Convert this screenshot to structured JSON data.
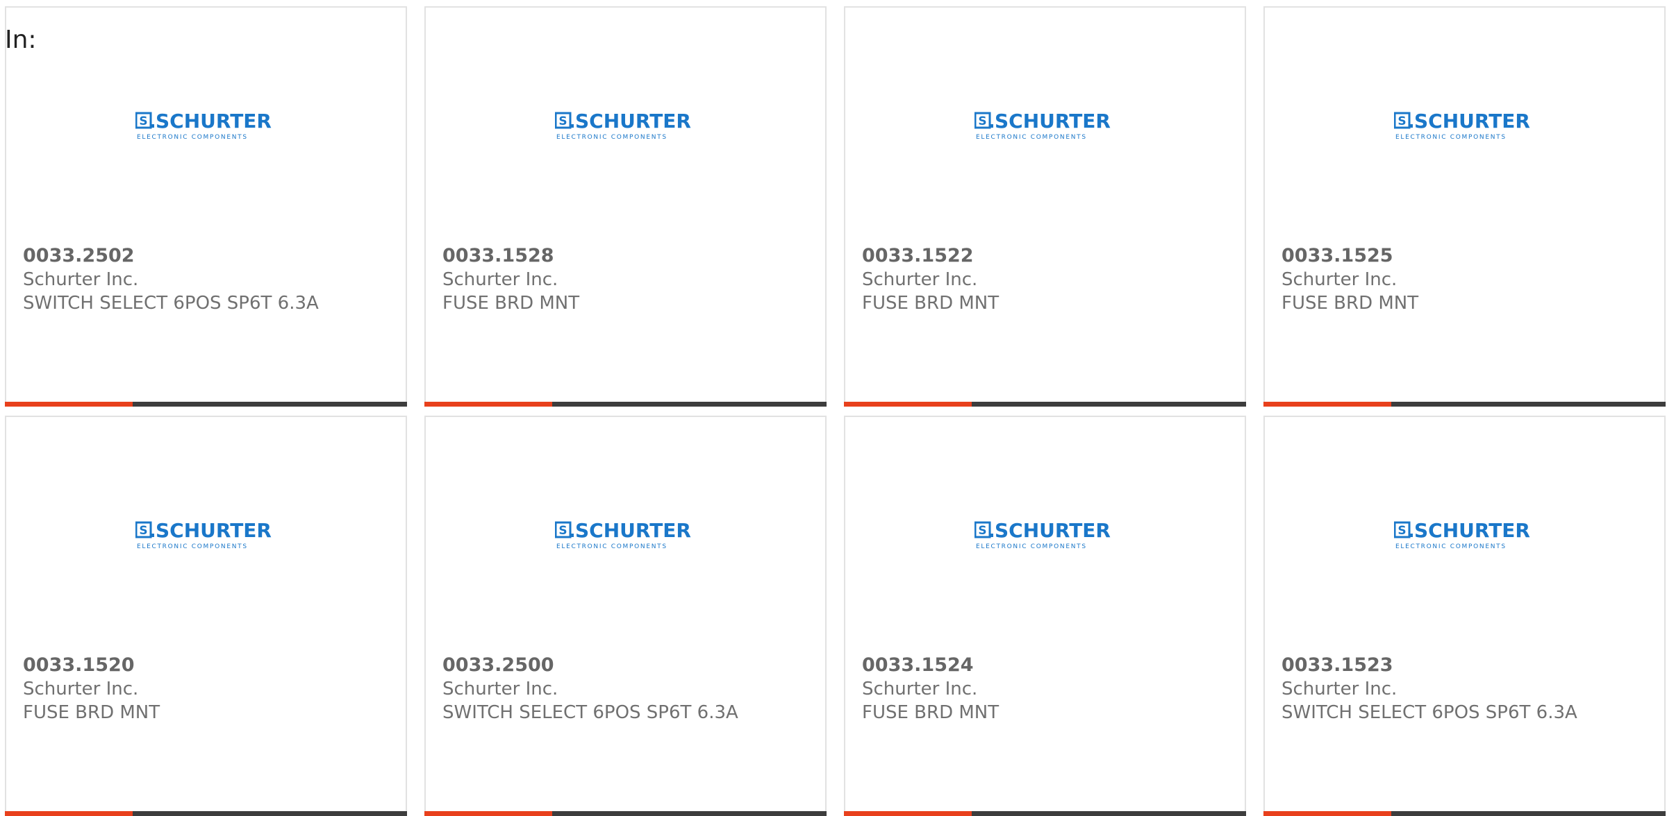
{
  "filter": {
    "label": "In:"
  },
  "colors": {
    "accent": "#e8401c",
    "bar_track": "#3d3d3d",
    "logo_blue": "#1a77c9",
    "border": "#e2e2e2"
  },
  "brand_logo": {
    "name": "SCHURTER",
    "tagline": "ELECTRONIC COMPONENTS",
    "icon": "schurter-logo"
  },
  "products": [
    {
      "part_number": "0033.2502",
      "manufacturer": "Schurter Inc.",
      "description": "SWITCH SELECT 6POS SP6T 6.3A"
    },
    {
      "part_number": "0033.1528",
      "manufacturer": "Schurter Inc.",
      "description": "FUSE BRD MNT"
    },
    {
      "part_number": "0033.1522",
      "manufacturer": "Schurter Inc.",
      "description": "FUSE BRD MNT"
    },
    {
      "part_number": "0033.1525",
      "manufacturer": "Schurter Inc.",
      "description": "FUSE BRD MNT"
    },
    {
      "part_number": "0033.1520",
      "manufacturer": "Schurter Inc.",
      "description": "FUSE BRD MNT"
    },
    {
      "part_number": "0033.2500",
      "manufacturer": "Schurter Inc.",
      "description": "SWITCH SELECT 6POS SP6T 6.3A"
    },
    {
      "part_number": "0033.1524",
      "manufacturer": "Schurter Inc.",
      "description": "FUSE BRD MNT"
    },
    {
      "part_number": "0033.1523",
      "manufacturer": "Schurter Inc.",
      "description": "SWITCH SELECT 6POS SP6T 6.3A"
    }
  ]
}
